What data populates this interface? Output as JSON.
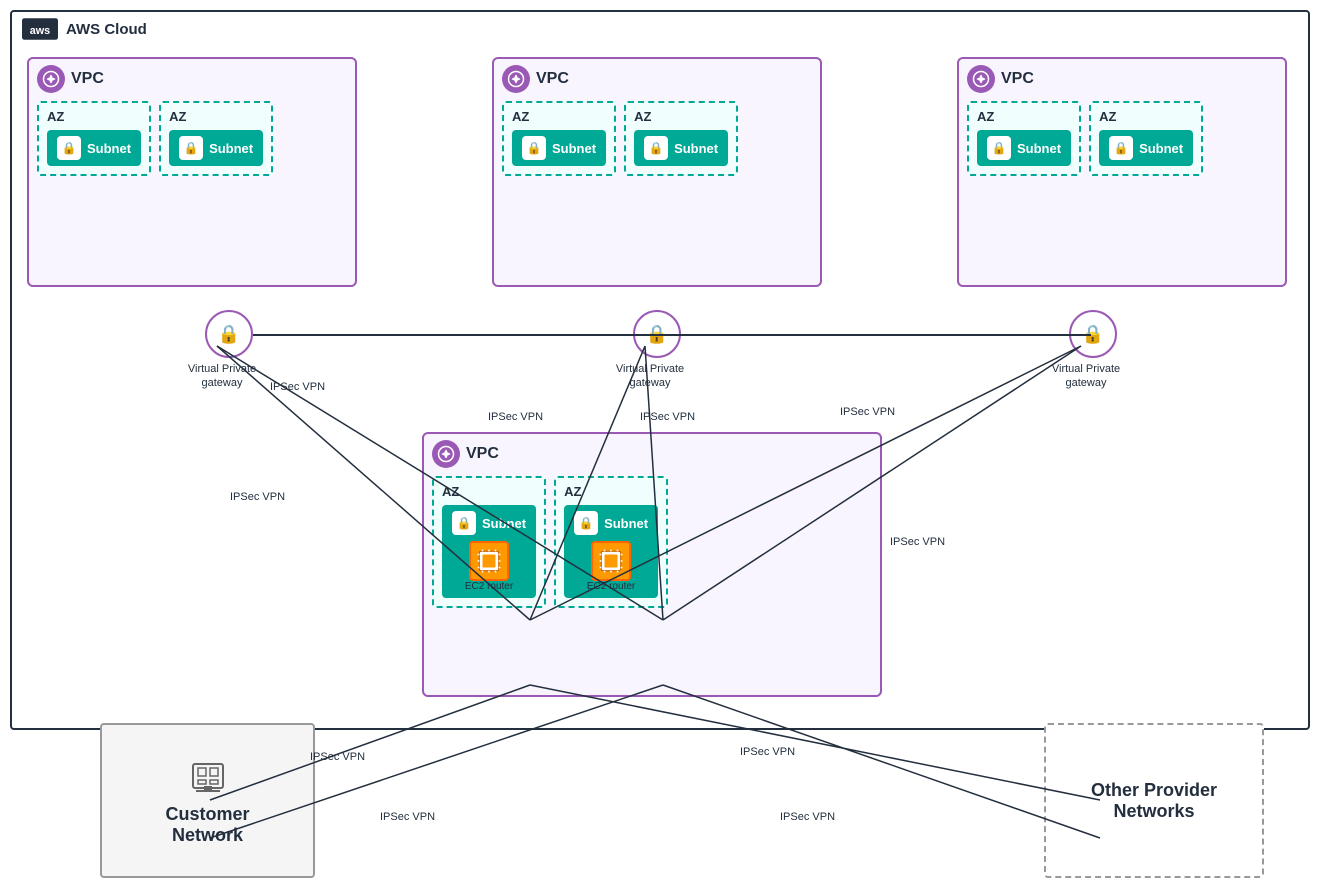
{
  "aws": {
    "header": "AWS Cloud",
    "logo_text": "aws"
  },
  "vpcs": [
    {
      "id": "vpc1",
      "label": "VPC",
      "azs": [
        {
          "label": "AZ",
          "subnets": [
            {
              "label": "Subnet"
            }
          ]
        },
        {
          "label": "AZ",
          "subnets": [
            {
              "label": "Subnet"
            }
          ]
        }
      ]
    },
    {
      "id": "vpc2",
      "label": "VPC",
      "azs": [
        {
          "label": "AZ",
          "subnets": [
            {
              "label": "Subnet"
            }
          ]
        },
        {
          "label": "AZ",
          "subnets": [
            {
              "label": "Subnet"
            }
          ]
        }
      ]
    },
    {
      "id": "vpc3",
      "label": "VPC",
      "azs": [
        {
          "label": "AZ",
          "subnets": [
            {
              "label": "Subnet"
            }
          ]
        },
        {
          "label": "AZ",
          "subnets": [
            {
              "label": "Subnet"
            }
          ]
        }
      ]
    },
    {
      "id": "vpc4",
      "label": "VPC",
      "azs": [
        {
          "label": "AZ",
          "subnets": [
            {
              "label": "Subnet",
              "has_ec2": true,
              "ec2_label": "EC2 router"
            }
          ]
        },
        {
          "label": "AZ",
          "subnets": [
            {
              "label": "Subnet",
              "has_ec2": true,
              "ec2_label": "EC2 router"
            }
          ]
        }
      ]
    }
  ],
  "gateways": [
    {
      "id": "gw1",
      "label": "Virtual Private\ngateway"
    },
    {
      "id": "gw2",
      "label": "Virtual Private\ngateway"
    },
    {
      "id": "gw3",
      "label": "Virtual Private\ngateway"
    }
  ],
  "ipsec_labels": [
    "IPSec VPN",
    "IPSec VPN",
    "IPSec VPN",
    "IPSec VPN",
    "IPSec VPN",
    "IPSec VPN",
    "IPSec VPN",
    "IPSec VPN"
  ],
  "customer_network": {
    "label": "Customer\nNetwork",
    "icon": "🏢"
  },
  "other_networks": {
    "label": "Other Provider\nNetworks"
  }
}
